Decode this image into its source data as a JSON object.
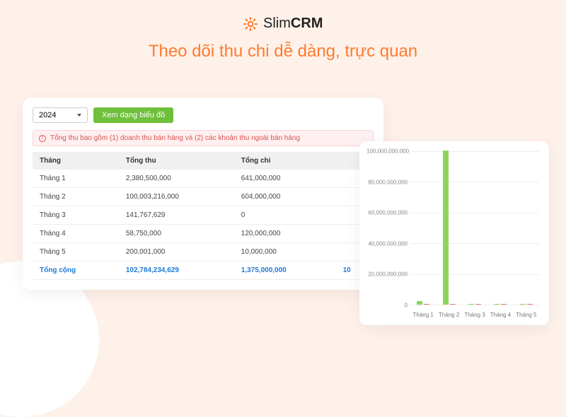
{
  "brand": {
    "name_light": "Slim",
    "name_bold": "CRM"
  },
  "tagline": "Theo dõi thu chi dễ dàng, trực quan",
  "controls": {
    "year_value": "2024",
    "view_chart_btn": "Xem dạng biểu đồ"
  },
  "notice": "Tổng thu bao gồm (1) doanh thu bán hàng và (2) các khoản thu ngoài bán hàng",
  "table": {
    "headers": {
      "month": "Tháng",
      "rev": "Tổng thu",
      "exp": "Tổng chi"
    },
    "rows": [
      {
        "month": "Tháng 1",
        "rev": "2,380,500,000",
        "exp": "641,000,000"
      },
      {
        "month": "Tháng 2",
        "rev": "100,003,216,000",
        "exp": "604,000,000"
      },
      {
        "month": "Tháng 3",
        "rev": "141,767,629",
        "exp": "0"
      },
      {
        "month": "Tháng 4",
        "rev": "58,750,000",
        "exp": "120,000,000"
      },
      {
        "month": "Tháng 5",
        "rev": "200,001,000",
        "exp": "10,000,000"
      }
    ],
    "total": {
      "label": "Tổng cộng",
      "rev": "102,784,234,629",
      "exp": "1,375,000,000",
      "cut": "10"
    }
  },
  "chart_data": {
    "type": "bar",
    "categories": [
      "Tháng 1",
      "Tháng 2",
      "Tháng 3",
      "Tháng 4",
      "Tháng 5"
    ],
    "series": [
      {
        "name": "Tổng thu",
        "color": "#8bd65a",
        "values": [
          2380500000,
          100003216000,
          141767629,
          58750000,
          200001000
        ]
      },
      {
        "name": "Tổng chi",
        "color": "#e57373",
        "values": [
          641000000,
          604000000,
          0,
          120000000,
          10000000
        ]
      }
    ],
    "ylim": [
      0,
      100000000000
    ],
    "y_ticks": [
      "0",
      "20,000,000,000",
      "40,000,000,000",
      "60,000,000,000",
      "80,000,000,000",
      "100,000,000,000"
    ]
  }
}
